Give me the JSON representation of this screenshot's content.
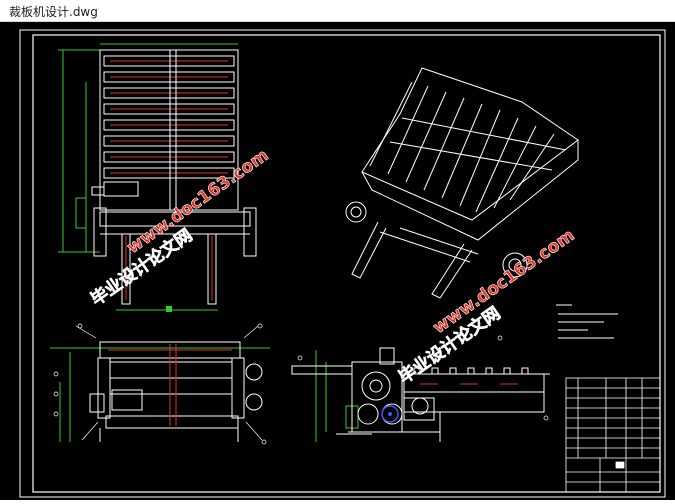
{
  "window": {
    "title": "裁板机设计.dwg"
  },
  "watermarks": [
    {
      "text": "毕业设计论文网",
      "color": "#e8352a"
    },
    {
      "text": "www.doc163.com",
      "color": "#e8352a"
    }
  ],
  "colors": {
    "background": "#000000",
    "outline": "#ffffff",
    "dimension": "#2dd02d",
    "hidden_parts": "#e03030",
    "accent": "#3a5cff",
    "watermark": "#e8352a"
  },
  "icons": [
    "drawing-view-icon"
  ]
}
